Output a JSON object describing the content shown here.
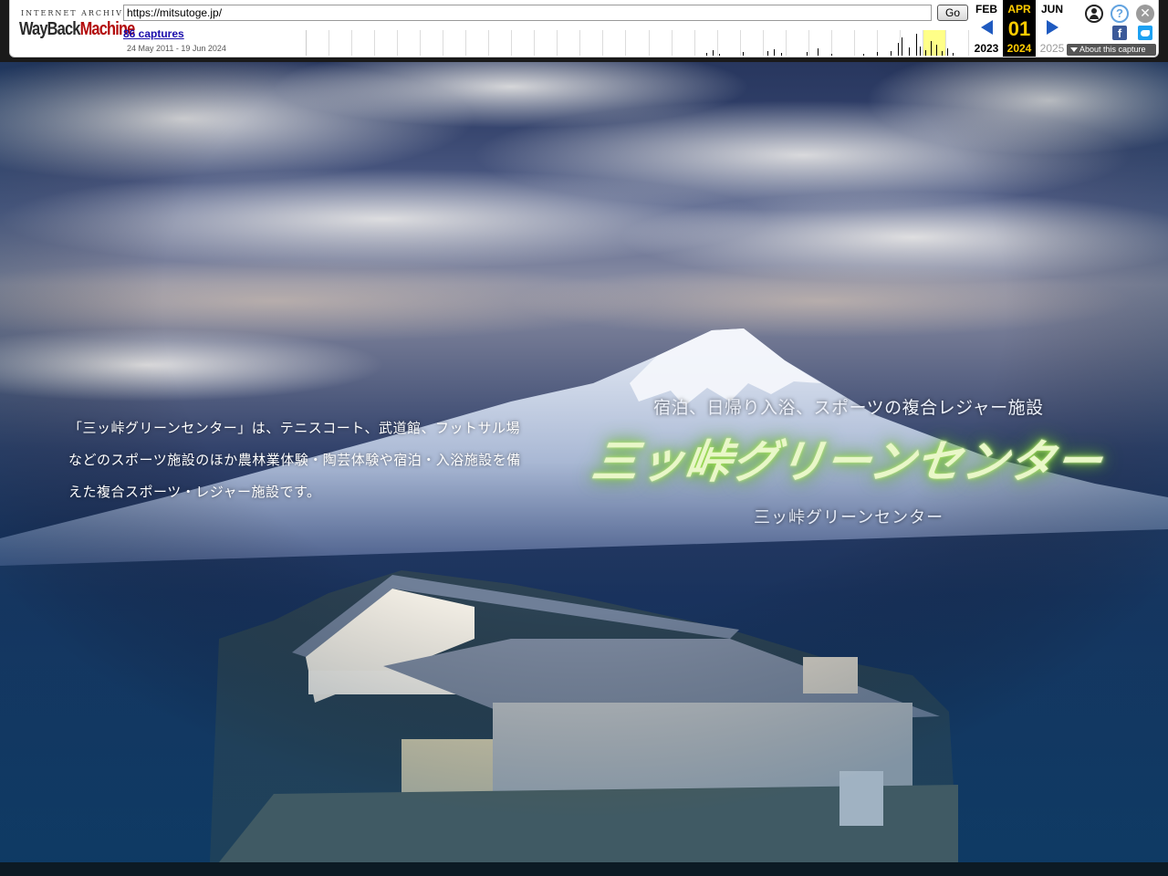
{
  "wayback": {
    "logo_top": "INTERNET ARCHIVE",
    "logo_wayback": "WayBack",
    "logo_machine": "Machine",
    "url": "https://mitsutoge.jp/",
    "go_label": "Go",
    "captures_label": "86 captures",
    "date_range": "24 May 2011 - 19 Jun 2024",
    "prev_month": "FEB",
    "prev_year": "2023",
    "current_month": "APR",
    "current_day": "01",
    "current_year": "2024",
    "next_month": "JUN",
    "next_year": "2025",
    "about_label": "About this capture",
    "icons": {
      "user": "user-account-icon",
      "help": "help-icon",
      "close": "close-icon",
      "facebook": "facebook-icon",
      "twitter": "twitter-icon",
      "prev": "prev-arrow-icon",
      "next": "next-arrow-icon"
    },
    "accent_color": "#ffcc00"
  },
  "hero": {
    "intro_lines": [
      "「三ッ峠グリーンセンター」は、テニスコート、武道館、フットサル場",
      "などのスポーツ施設のほか農林業体験・陶芸体験や宿泊・入浴施設を備",
      "えた複合スポーツ・レジャー施設です。"
    ],
    "tagline": "宿泊、日帰り入浴、スポーツの複合レジャー施設",
    "logo_text": "三ッ峠グリーンセンター",
    "logo_subtitle": "三ッ峠グリーンセンター",
    "logo_glow_color": "#a6e25a"
  }
}
